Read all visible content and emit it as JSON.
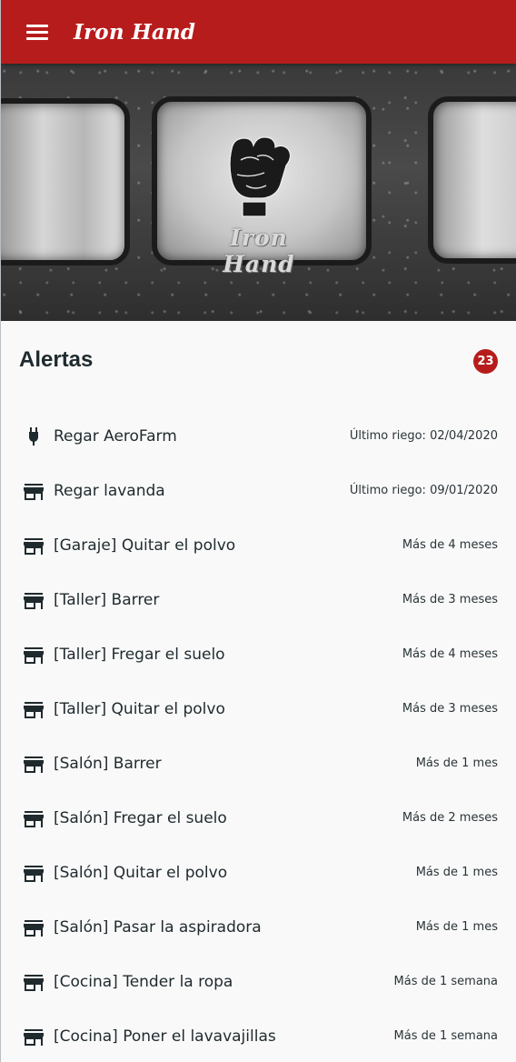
{
  "appbar": {
    "title": "Iron Hand",
    "menu_icon": "menu-icon"
  },
  "hero": {
    "logo_text": "Iron Hand",
    "logo_icon": "raised-fist-icon"
  },
  "alerts": {
    "title": "Alertas",
    "count": "23",
    "items": [
      {
        "icon": "plug-icon",
        "label": "Regar AeroFarm",
        "meta": "Último riego: 02/04/2020"
      },
      {
        "icon": "store-icon",
        "label": "Regar lavanda",
        "meta": "Último riego: 09/01/2020"
      },
      {
        "icon": "store-icon",
        "label": "[Garaje] Quitar el polvo",
        "meta": "Más de 4 meses"
      },
      {
        "icon": "store-icon",
        "label": "[Taller] Barrer",
        "meta": "Más de 3 meses"
      },
      {
        "icon": "store-icon",
        "label": "[Taller] Fregar el suelo",
        "meta": "Más de 4 meses"
      },
      {
        "icon": "store-icon",
        "label": "[Taller] Quitar el polvo",
        "meta": "Más de 3 meses"
      },
      {
        "icon": "store-icon",
        "label": "[Salón] Barrer",
        "meta": "Más de 1 mes"
      },
      {
        "icon": "store-icon",
        "label": "[Salón] Fregar el suelo",
        "meta": "Más de 2 meses"
      },
      {
        "icon": "store-icon",
        "label": "[Salón] Quitar el polvo",
        "meta": "Más de 1 mes"
      },
      {
        "icon": "store-icon",
        "label": "[Salón] Pasar la aspiradora",
        "meta": "Más de 1 mes"
      },
      {
        "icon": "store-icon",
        "label": "[Cocina] Tender la ropa",
        "meta": "Más de 1 semana"
      },
      {
        "icon": "store-icon",
        "label": "[Cocina] Poner el lavavajillas",
        "meta": "Más de 1 semana"
      }
    ]
  },
  "colors": {
    "primary": "#b71c1c",
    "text": "#1f2a2e",
    "background": "#f9f9f9"
  }
}
